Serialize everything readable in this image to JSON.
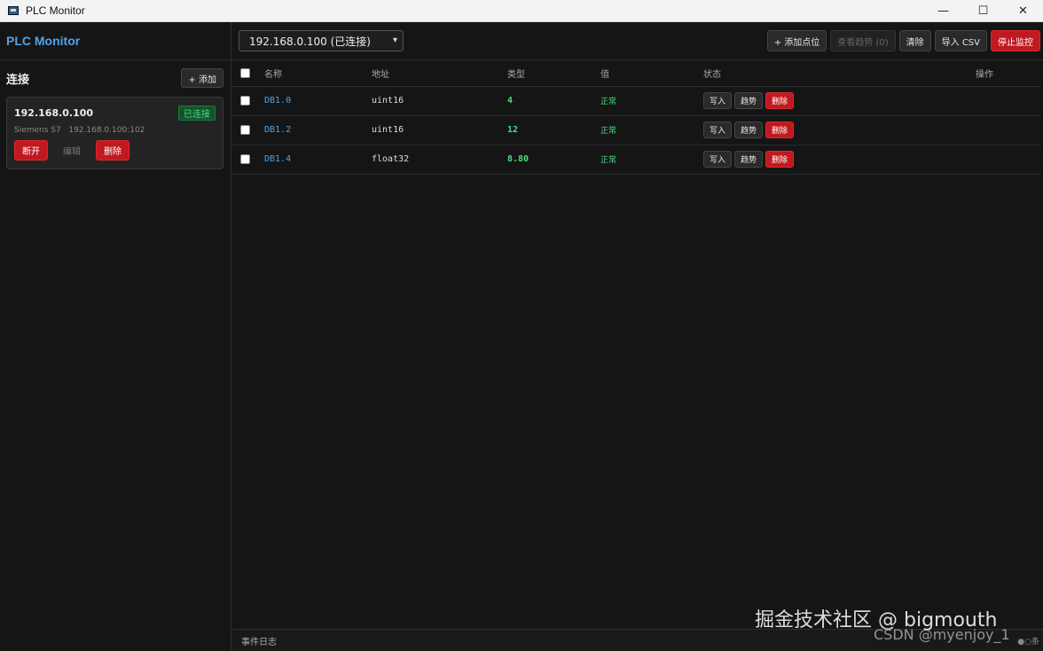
{
  "window": {
    "title": "PLC Monitor",
    "minimize": "—",
    "maximize": "☐",
    "close": "✕"
  },
  "sidebar": {
    "brand": "PLC Monitor",
    "section_title": "连接",
    "add_label": "+ 添加",
    "connection": {
      "ip": "192.168.0.100",
      "status": "已连接",
      "vendor": "Siemens S7",
      "endpoint": "192.168.0.100:102",
      "disconnect_label": "断开",
      "edit_label": "编辑",
      "delete_label": "删除"
    }
  },
  "toolbar": {
    "selected_connection": "192.168.0.100 (已连接)",
    "add_point": "+ 添加点位",
    "view_trend": "查看趋势 (0)",
    "clear": "清除",
    "import_csv": "导入 CSV",
    "stop_monitor": "停止监控"
  },
  "table": {
    "headers": {
      "name": "名称",
      "address": "地址",
      "type": "类型",
      "value": "值",
      "status": "状态",
      "actions": "操作"
    },
    "rows": [
      {
        "name": "DB1.0",
        "address": "uint16",
        "value": "4",
        "status": "正常"
      },
      {
        "name": "DB1.2",
        "address": "uint16",
        "value": "12",
        "status": "正常"
      },
      {
        "name": "DB1.4",
        "address": "float32",
        "value": "8.80",
        "status": "正常"
      }
    ],
    "row_actions": {
      "write": "写入",
      "trend": "趋势",
      "delete": "删除"
    }
  },
  "footer": {
    "log_label": "事件日志",
    "right_text": "●○条"
  },
  "watermark": {
    "line1": "掘金技术社区 @ bigmouth",
    "line2": "CSDN @myenjoy_1"
  },
  "colors": {
    "accent": "#4fa3e8",
    "danger": "#c0191f",
    "ok": "#4ade80"
  }
}
